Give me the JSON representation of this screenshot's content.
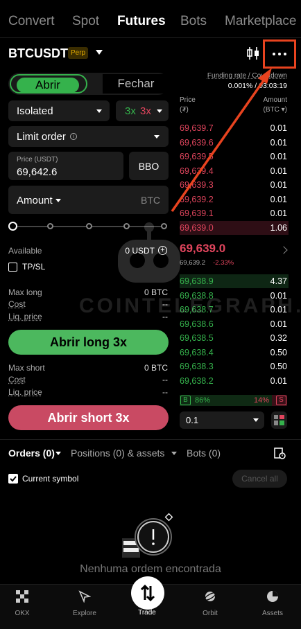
{
  "top_tabs": [
    "Convert",
    "Spot",
    "Futures",
    "Bots",
    "Marketplace"
  ],
  "header": {
    "pair": "BTCUSDT",
    "perp_badge": "Perp"
  },
  "toggle": {
    "open": "Abrir",
    "close": "Fechar"
  },
  "margin": {
    "mode": "Isolated",
    "leverage_long": "3x",
    "leverage_short": "3x"
  },
  "order_type": {
    "label": "Limit order",
    "info": "i"
  },
  "price_field": {
    "label": "Price (USDT)",
    "value": "69,642.6",
    "bbo": "BBO"
  },
  "amount_field": {
    "label": "Amount",
    "unit": "BTC"
  },
  "slider_value": 0,
  "available": {
    "label": "Available",
    "value": "0 USDT",
    "plus": "+"
  },
  "tpsl": {
    "label": "TP/SL"
  },
  "long_info": {
    "max_label": "Max long",
    "max_value": "0 BTC",
    "cost_label": "Cost",
    "cost_value": "--",
    "liq_label": "Liq. price",
    "liq_value": "--"
  },
  "short_info": {
    "max_label": "Max short",
    "max_value": "0 BTC",
    "cost_label": "Cost",
    "cost_value": "--",
    "liq_label": "Liq. price",
    "liq_value": "--"
  },
  "buttons": {
    "long": "Abrir long 3x",
    "short": "Abrir short 3x"
  },
  "orderbook": {
    "funding_label": "Funding rate / Countdown",
    "funding_value": "0.001% / 03:03:19",
    "col_price": "Price",
    "col_price_unit": "(₮)",
    "col_amount": "Amount",
    "col_amount_unit": "(BTC ▾)",
    "asks": [
      {
        "price": "69,639.7",
        "amount": "0.01"
      },
      {
        "price": "69,639.6",
        "amount": "0.01"
      },
      {
        "price": "69,639.5",
        "amount": "0.01"
      },
      {
        "price": "69,639.4",
        "amount": "0.01"
      },
      {
        "price": "69,639.3",
        "amount": "0.01"
      },
      {
        "price": "69,639.2",
        "amount": "0.01"
      },
      {
        "price": "69,639.1",
        "amount": "0.01"
      },
      {
        "price": "69,639.0",
        "amount": "1.06"
      }
    ],
    "last_price": "69,639.0",
    "mark_price": "69,639.2",
    "change": "-2.33%",
    "bids": [
      {
        "price": "69,638.9",
        "amount": "4.37"
      },
      {
        "price": "69,638.8",
        "amount": "0.01"
      },
      {
        "price": "69,638.7",
        "amount": "0.01"
      },
      {
        "price": "69,638.6",
        "amount": "0.01"
      },
      {
        "price": "69,638.5",
        "amount": "0.32"
      },
      {
        "price": "69,638.4",
        "amount": "0.50"
      },
      {
        "price": "69,638.3",
        "amount": "0.50"
      },
      {
        "price": "69,638.2",
        "amount": "0.01"
      }
    ],
    "buy_badge": "B",
    "buy_pct": "86%",
    "sell_pct": "14%",
    "sell_badge": "S",
    "depth": "0.1"
  },
  "order_tabs": [
    "Orders (0)",
    "Positions (0) & assets",
    "Bots (0)"
  ],
  "current_symbol": "Current symbol",
  "cancel_all": "Cancel all",
  "empty_text": "Nenhuma ordem encontrada",
  "watermark": "COINTELEGRAPH.RU",
  "nav": [
    "OKX",
    "Explore",
    "Trade",
    "Orbit",
    "Assets"
  ],
  "colors": {
    "green": "#35b24c",
    "red": "#e0455d",
    "short_button": "#c94a63",
    "highlight": "#e8431f"
  }
}
